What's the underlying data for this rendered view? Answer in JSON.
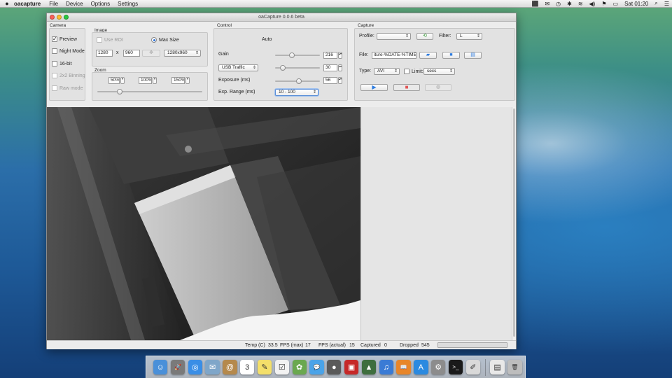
{
  "menubar": {
    "app": "oacapture",
    "menus": [
      "File",
      "Device",
      "Options",
      "Settings"
    ],
    "clock": "Sat 01:20"
  },
  "window": {
    "title": "oaCapture 0.0.6 beta"
  },
  "camera": {
    "title": "Camera",
    "preview": "Preview",
    "night_mode": "Night Mode",
    "bit16": "16-bit",
    "binning": "2x2 Binning",
    "raw_mode": "Raw mode"
  },
  "image": {
    "title": "Image",
    "use_roi": "Use ROI",
    "max_size": "Max Size",
    "width": "1280",
    "x": "x",
    "height": "960",
    "resolution": "1280x960"
  },
  "zoom": {
    "title": "Zoom",
    "z50": "50%",
    "z100": "100%",
    "z150": "150%",
    "slider_level": 0.2
  },
  "control": {
    "title": "Control",
    "auto": "Auto",
    "gain_label": "Gain",
    "gain_value": "216",
    "gain_level": 0.35,
    "usb_traffic": "USB Traffic",
    "usb_value": "30",
    "usb_level": 0.12,
    "exposure_label": "Exposure (ms)",
    "exposure_value": "56",
    "exposure_level": 0.53,
    "exp_range_label": "Exp. Range (ms)",
    "exp_range_value": "10 - 100"
  },
  "capture": {
    "title": "Capture",
    "profile_label": "Profile:",
    "profile_value": "",
    "filter_label": "Filter:",
    "filter_value": "L",
    "file_label": "File:",
    "file_value": "iture-%DATE-%TIME",
    "type_label": "Type:",
    "type_value": "AVI",
    "limit_label": "Limit:",
    "limit_value": "secs"
  },
  "status": {
    "temp_label": "Temp (C)",
    "temp_value": "33.5",
    "fps_max_label": "FPS (max)",
    "fps_max_value": "17",
    "fps_actual_label": "FPS (actual)",
    "fps_actual_value": "15",
    "captured_label": "Captured",
    "captured_value": "0",
    "dropped_label": "Dropped",
    "dropped_value": "545",
    "progress": 0
  },
  "colors": {
    "accent": "#2a6fd6",
    "record_red": "#e25555",
    "play_blue": "#2f7de0"
  },
  "dock": {
    "icons": [
      {
        "name": "finder-icon",
        "bg": "#4a90d9",
        "glyph": "☺"
      },
      {
        "name": "launchpad-icon",
        "bg": "#7a7a7a",
        "glyph": "🚀"
      },
      {
        "name": "safari-icon",
        "bg": "#3a8ee6",
        "glyph": "◎"
      },
      {
        "name": "mail-icon",
        "bg": "#7fa6c9",
        "glyph": "✉"
      },
      {
        "name": "contacts-icon",
        "bg": "#b5894c",
        "glyph": "@"
      },
      {
        "name": "calendar-icon",
        "bg": "#ffffff",
        "glyph": "3"
      },
      {
        "name": "notes-icon",
        "bg": "#f3df6a",
        "glyph": "✎"
      },
      {
        "name": "reminders-icon",
        "bg": "#f2f2f2",
        "glyph": "☑"
      },
      {
        "name": "photos-icon",
        "bg": "#6aa84f",
        "glyph": "✿"
      },
      {
        "name": "messages-icon",
        "bg": "#4aa3e8",
        "glyph": "💬"
      },
      {
        "name": "facetime-icon",
        "bg": "#5a5a5a",
        "glyph": "●"
      },
      {
        "name": "photobooth-icon",
        "bg": "#c62828",
        "glyph": "▣"
      },
      {
        "name": "iphoto-icon",
        "bg": "#3e6e3e",
        "glyph": "▲"
      },
      {
        "name": "itunes-icon",
        "bg": "#3a7bd5",
        "glyph": "♫"
      },
      {
        "name": "ibooks-icon",
        "bg": "#e8862a",
        "glyph": "📖"
      },
      {
        "name": "appstore-icon",
        "bg": "#2b8ae0",
        "glyph": "A"
      },
      {
        "name": "system-preferences-icon",
        "bg": "#8c8c8c",
        "glyph": "⚙"
      },
      {
        "name": "terminal-icon",
        "bg": "#1a1a1a",
        "glyph": ">_"
      },
      {
        "name": "script-editor-icon",
        "bg": "#d9d9d9",
        "glyph": "✐"
      }
    ],
    "trailing": [
      {
        "name": "documents-stack-icon",
        "bg": "#e8e8e8",
        "glyph": "▤"
      },
      {
        "name": "trash-icon",
        "bg": "#bdbdbd",
        "glyph": "🗑"
      }
    ]
  }
}
